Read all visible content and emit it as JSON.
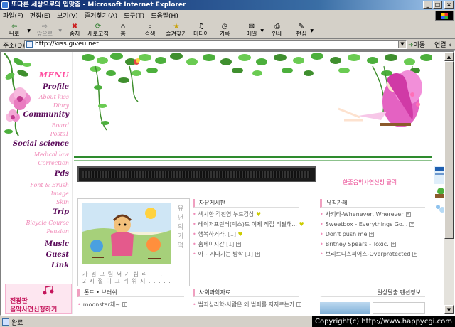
{
  "window": {
    "title": "또다른 세상으로의 입맞춤 - Microsoft Internet Explorer",
    "buttons": {
      "minimize": "_",
      "maximize": "□",
      "close": "×"
    }
  },
  "menubar": [
    "파일(F)",
    "편집(E)",
    "보기(V)",
    "즐겨찾기(A)",
    "도구(T)",
    "도움말(H)"
  ],
  "toolbar": {
    "items": [
      {
        "label": "뒤로",
        "icon": "back-icon",
        "glyph": "⇦"
      },
      {
        "label": "앞으로",
        "icon": "forward-icon",
        "glyph": "⇨"
      },
      {
        "label": "중지",
        "icon": "stop-icon",
        "glyph": "✖"
      },
      {
        "label": "새로고침",
        "icon": "refresh-icon",
        "glyph": "⟳"
      },
      {
        "label": "홈",
        "icon": "home-icon",
        "glyph": "⌂"
      },
      {
        "label": "검색",
        "icon": "search-icon",
        "glyph": "⌕"
      },
      {
        "label": "즐겨찾기",
        "icon": "favorites-icon",
        "glyph": "★"
      },
      {
        "label": "미디어",
        "icon": "media-icon",
        "glyph": "♫"
      },
      {
        "label": "기록",
        "icon": "history-icon",
        "glyph": "◷"
      },
      {
        "label": "메일",
        "icon": "mail-icon",
        "glyph": "✉"
      },
      {
        "label": "인쇄",
        "icon": "print-icon",
        "glyph": "⎙"
      },
      {
        "label": "편집",
        "icon": "edit-icon",
        "glyph": "✎"
      }
    ]
  },
  "address": {
    "label": "주소(D)",
    "url": "http://kiss.giveu.net",
    "go": "이동",
    "links": "연결 »"
  },
  "sidebar": {
    "menu_title": "MENU",
    "items": [
      {
        "label": "Profile",
        "kind": "main"
      },
      {
        "label": "About kiss",
        "kind": "sub"
      },
      {
        "label": "Diary",
        "kind": "sub"
      },
      {
        "label": "Community",
        "kind": "main"
      },
      {
        "label": "Board",
        "kind": "sub"
      },
      {
        "label": "Posts1",
        "kind": "sub"
      },
      {
        "label": "Social science",
        "kind": "main"
      },
      {
        "label": "Medical law",
        "kind": "sub"
      },
      {
        "label": "Correction",
        "kind": "sub"
      },
      {
        "label": "Pds",
        "kind": "main"
      },
      {
        "label": "Font & Brush",
        "kind": "sub"
      },
      {
        "label": "Image",
        "kind": "sub"
      },
      {
        "label": "Skin",
        "kind": "sub"
      },
      {
        "label": "Trip",
        "kind": "main"
      },
      {
        "label": "Bicycle Course",
        "kind": "sub"
      },
      {
        "label": "Pension",
        "kind": "sub"
      },
      {
        "label": "Music",
        "kind": "main"
      },
      {
        "label": "Guest",
        "kind": "main"
      },
      {
        "label": "Link",
        "kind": "main"
      }
    ],
    "banner": {
      "line1": "전광판",
      "line2": "음악사연신청하기"
    }
  },
  "main": {
    "music_request": "한줄음악사연신청 클릭",
    "photo": {
      "vertical_text": [
        "유",
        "년",
        "의",
        "기",
        "억"
      ],
      "caption_line1": "가 펌  그 림 써 기  십 리 . . .",
      "caption_line2": "2  시 절 이  그 리 워 지 . . . . ."
    },
    "freeboard": {
      "title": "자유게시판",
      "items": [
        {
          "text": "섹시한 각진영 누드감상",
          "count": "",
          "new": true
        },
        {
          "text": "레이저프린터(렉스)도 이제 직접 리필해...",
          "count": "",
          "new": true
        },
        {
          "text": "행복하거라.",
          "count": "[1]",
          "new": true
        },
        {
          "text": "홈페이지간",
          "count": "[1]",
          "new": false
        },
        {
          "text": "아~ 지나가는 방학",
          "count": "[1]",
          "new": false
        }
      ]
    },
    "lyrics": {
      "title": "뮤직가레",
      "items": [
        {
          "text": "사키라-Whenever, Wherever"
        },
        {
          "text": "Sweetbox - Everythings Go..."
        },
        {
          "text": "Don't push me"
        },
        {
          "text": "Britney Spears - Toxic."
        },
        {
          "text": "브리트니스피어스-Overprotected"
        }
      ]
    },
    "font_box": {
      "title": "폰트 • 브러쉬",
      "items": [
        {
          "text": "moonstar체~"
        }
      ]
    },
    "social_box": {
      "title": "사회과학자료",
      "items": [
        {
          "text": "범죄심리학-사람은 왜 범죄를 저지르는가"
        }
      ]
    },
    "hot_box": {
      "title": "일상탈출 펜션정보"
    }
  },
  "status": {
    "text": "완료",
    "copyright": "Copyright(c) http://www.happycgi.com"
  },
  "colors": {
    "title_bar": "#0a246a",
    "menu_main": "#5a0a5a",
    "menu_sub": "#f08ab8",
    "accent_pink": "#e83e8c",
    "leaf_green": "#4caf3c"
  }
}
